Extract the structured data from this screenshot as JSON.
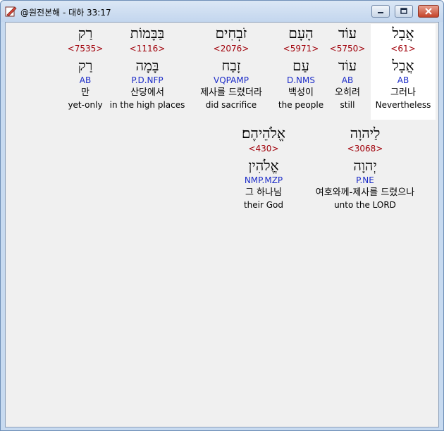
{
  "window": {
    "title": "@원전본해 - 대하 33:17"
  },
  "words_row1": [
    {
      "hebrew": "אֲבָל",
      "strong": "<61>",
      "lemma": "אֲבָל",
      "morph": "AB",
      "korean": "그러나",
      "english": "Nevertheless"
    },
    {
      "hebrew": "עוֹד",
      "strong": "<5750>",
      "lemma": "עוֹד",
      "morph": "AB",
      "korean": "오히려",
      "english": "still"
    },
    {
      "hebrew": "הָעָם",
      "strong": "<5971>",
      "lemma": "עַם",
      "morph": "D.NMS",
      "korean": "백성이",
      "english": "the people"
    },
    {
      "hebrew": "זֹבְחִים",
      "strong": "<2076>",
      "lemma": "זָבַח",
      "morph": "VQPAMP",
      "korean": "제사를 드렸더라",
      "english": "did sacrifice"
    },
    {
      "hebrew": "בַּבָּמוֹת",
      "strong": "<1116>",
      "lemma": "בָּמָה",
      "morph": "P.D.NFP",
      "korean": "산당에서",
      "english": "in the high places"
    },
    {
      "hebrew": "רַק",
      "strong": "<7535>",
      "lemma": "רַק",
      "morph": "AB",
      "korean": "만",
      "english": "yet-only"
    }
  ],
  "words_row2": [
    {
      "hebrew": "לַיהוָה",
      "strong": "<3068>",
      "lemma": "יְהוָה",
      "morph": "P.NE",
      "korean": "여호와께-제사를 드렸으나",
      "english": "unto the LORD"
    },
    {
      "hebrew": "אֱלֹהֵיהֶם׃",
      "strong": "<430>",
      "lemma": "אֱלֹהִין",
      "morph": "NMP.MZP",
      "korean": "그 하나님",
      "english": "their God"
    }
  ]
}
